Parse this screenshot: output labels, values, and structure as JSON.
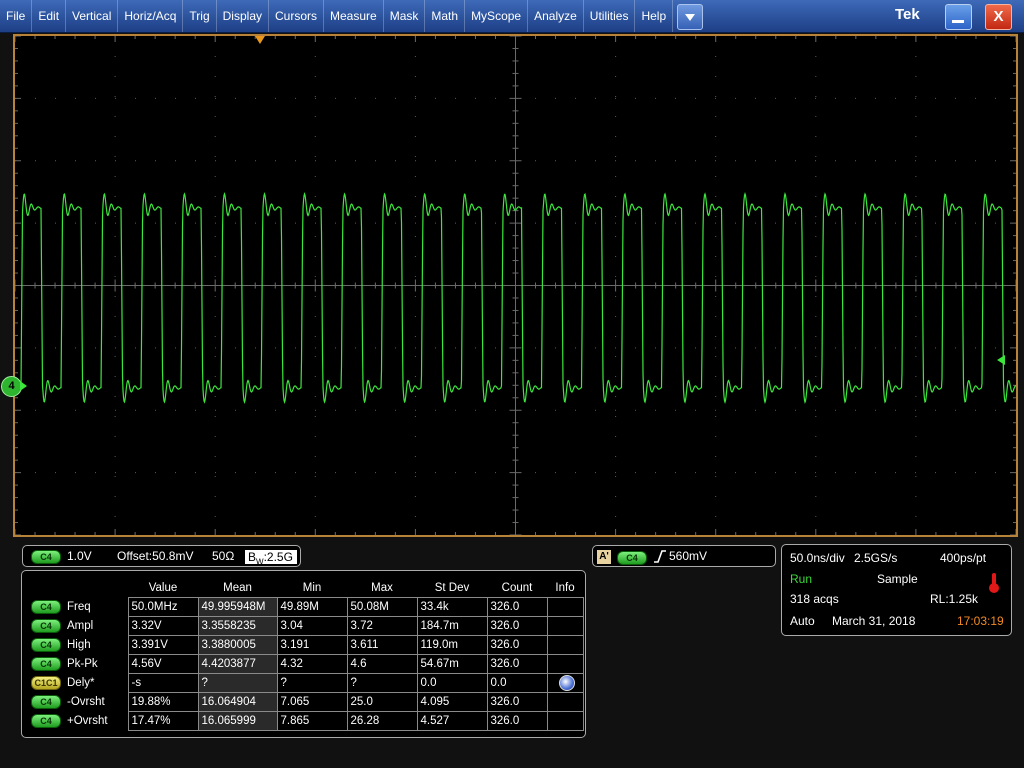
{
  "menu": {
    "items": [
      "File",
      "Edit",
      "Vertical",
      "Horiz/Acq",
      "Trig",
      "Display",
      "Cursors",
      "Measure",
      "Mask",
      "Math",
      "MyScope",
      "Analyze",
      "Utilities",
      "Help"
    ],
    "brand": "Tek",
    "close_label": "X"
  },
  "display": {
    "channel_marker": "4",
    "trace_color": "#3ce63c",
    "grid_color": "#5a5a5a"
  },
  "vertical": {
    "channel": "C4",
    "scale": "1.0V",
    "offset": "Offset:50.8mV",
    "impedance": "50Ω",
    "bandwidth_prefix": "B",
    "bandwidth_sub": "W",
    "bandwidth": ":2.5G"
  },
  "measurements": {
    "headers": [
      "Value",
      "Mean",
      "Min",
      "Max",
      "St Dev",
      "Count",
      "Info"
    ],
    "rows": [
      {
        "source": "C4",
        "label": "Freq",
        "value": "50.0MHz",
        "mean": "49.995948M",
        "min": "49.89M",
        "max": "50.08M",
        "stdev": "33.4k",
        "count": "326.0"
      },
      {
        "source": "C4",
        "label": "Ampl",
        "value": "3.32V",
        "mean": "3.3558235",
        "min": "3.04",
        "max": "3.72",
        "stdev": "184.7m",
        "count": "326.0"
      },
      {
        "source": "C4",
        "label": "High",
        "value": "3.391V",
        "mean": "3.3880005",
        "min": "3.191",
        "max": "3.611",
        "stdev": "119.0m",
        "count": "326.0"
      },
      {
        "source": "C4",
        "label": "Pk-Pk",
        "value": "4.56V",
        "mean": "4.4203877",
        "min": "4.32",
        "max": "4.6",
        "stdev": "54.67m",
        "count": "326.0"
      },
      {
        "source": "C1C1",
        "label": "Dely*",
        "value": "-s",
        "mean": "?",
        "min": "?",
        "max": "?",
        "stdev": "0.0",
        "count": "0.0"
      },
      {
        "source": "C4",
        "label": "-Ovrsht",
        "value": "19.88%",
        "mean": "16.064904",
        "min": "7.065",
        "max": "25.0",
        "stdev": "4.095",
        "count": "326.0"
      },
      {
        "source": "C4",
        "label": "+Ovrsht",
        "value": "17.47%",
        "mean": "16.065999",
        "min": "7.865",
        "max": "26.28",
        "stdev": "4.527",
        "count": "326.0"
      }
    ]
  },
  "trigger": {
    "badge": "A'",
    "channel": "C4",
    "level": "560mV"
  },
  "horizontal": {
    "timebase": "50.0ns/div",
    "sample_rate": "2.5GS/s",
    "resolution": "400ps/pt",
    "state": "Run",
    "mode": "Sample",
    "acqs": "318 acqs",
    "record_length": "RL:1.25k",
    "trigger_mode": "Auto",
    "date": "March 31, 2018",
    "time": "17:03:19"
  }
}
